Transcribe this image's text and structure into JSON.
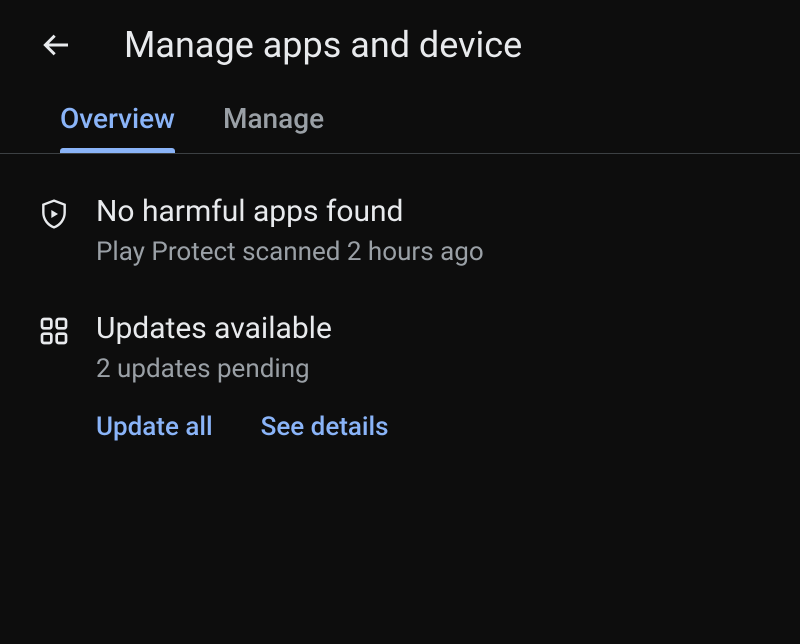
{
  "header": {
    "title": "Manage apps and device"
  },
  "tabs": [
    {
      "label": "Overview",
      "active": true
    },
    {
      "label": "Manage",
      "active": false
    }
  ],
  "sections": {
    "protect": {
      "title": "No harmful apps found",
      "subtitle": "Play Protect scanned 2 hours ago"
    },
    "updates": {
      "title": "Updates available",
      "subtitle": "2 updates pending",
      "actions": {
        "update_all": "Update all",
        "see_details": "See details"
      }
    }
  }
}
